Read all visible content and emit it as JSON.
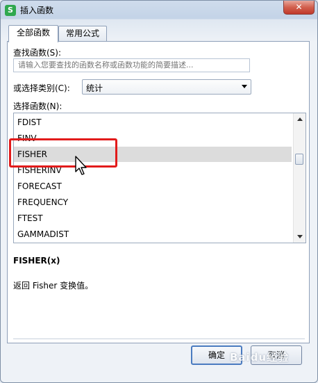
{
  "window": {
    "title": "插入函数",
    "app_icon": "S",
    "close_label": "✕"
  },
  "tabs": [
    {
      "label": "全部函数",
      "active": true
    },
    {
      "label": "常用公式",
      "active": false
    }
  ],
  "search": {
    "label": "查找函数(S):",
    "placeholder": "请输入您要查找的函数名称或函数功能的简要描述..."
  },
  "category": {
    "label": "或选择类别(C):",
    "value": "统计"
  },
  "function_list": {
    "label": "选择函数(N):",
    "items": [
      "FDIST",
      "FINV",
      "FISHER",
      "FISHERINV",
      "FORECAST",
      "FREQUENCY",
      "FTEST",
      "GAMMADIST"
    ],
    "selected": "FISHER"
  },
  "details": {
    "signature": "FISHER(x)",
    "description": "返回 Fisher 变换值。"
  },
  "buttons": {
    "ok": "确定",
    "cancel": "取消"
  },
  "watermark": "Baidu经验",
  "colors": {
    "highlight": "#e21b1b",
    "selection": "#dcdcdc",
    "app_icon": "#2fa84f"
  }
}
